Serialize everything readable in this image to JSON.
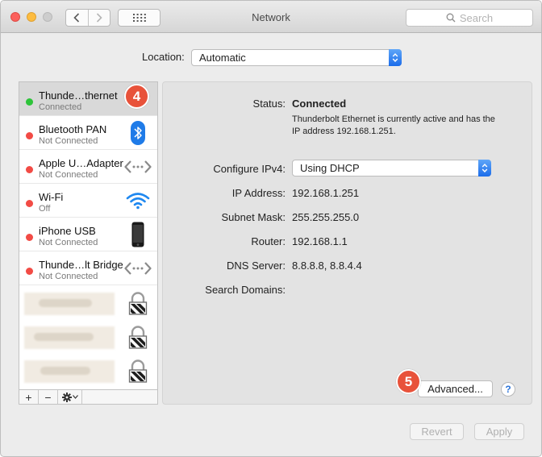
{
  "window": {
    "title": "Network"
  },
  "search": {
    "placeholder": "Search"
  },
  "location": {
    "label": "Location:",
    "value": "Automatic"
  },
  "services": [
    {
      "name": "Thunde…thernet",
      "status": "Connected",
      "status_color": "#2ec43a",
      "icon": "ethernet-icon",
      "selected": true
    },
    {
      "name": "Bluetooth PAN",
      "status": "Not Connected",
      "status_color": "#f24b45",
      "icon": "bluetooth-icon"
    },
    {
      "name": "Apple U…Adapter",
      "status": "Not Connected",
      "status_color": "#f24b45",
      "icon": "ethernet-arrows-icon"
    },
    {
      "name": "Wi-Fi",
      "status": "Off",
      "status_color": "#f24b45",
      "icon": "wifi-icon"
    },
    {
      "name": "iPhone USB",
      "status": "Not Connected",
      "status_color": "#f24b45",
      "icon": "iphone-icon"
    },
    {
      "name": "Thunde…lt Bridge",
      "status": "Not Connected",
      "status_color": "#f24b45",
      "icon": "ethernet-arrows-icon"
    }
  ],
  "vpn_rows": [
    {
      "icon": "lock-icon"
    },
    {
      "icon": "lock-icon"
    },
    {
      "icon": "lock-icon"
    }
  ],
  "sidebar_toolbar": {
    "add": "+",
    "remove": "−"
  },
  "annotations": {
    "badge_4": "4",
    "badge_5": "5",
    "badge_color": "#e8523a"
  },
  "detail": {
    "status_label": "Status:",
    "status_value": "Connected",
    "status_description": "Thunderbolt Ethernet is currently active and has the IP address 192.168.1.251.",
    "configure_label": "Configure IPv4:",
    "configure_value": "Using DHCP",
    "ip_label": "IP Address:",
    "ip_value": "192.168.1.251",
    "subnet_label": "Subnet Mask:",
    "subnet_value": "255.255.255.0",
    "router_label": "Router:",
    "router_value": "192.168.1.1",
    "dns_label": "DNS Server:",
    "dns_value": "8.8.8.8, 8.8.4.4",
    "search_domains_label": "Search Domains:",
    "search_domains_value": ""
  },
  "buttons": {
    "advanced": "Advanced...",
    "help": "?",
    "revert": "Revert",
    "apply": "Apply"
  },
  "colors": {
    "accent": "#1b6cea"
  }
}
